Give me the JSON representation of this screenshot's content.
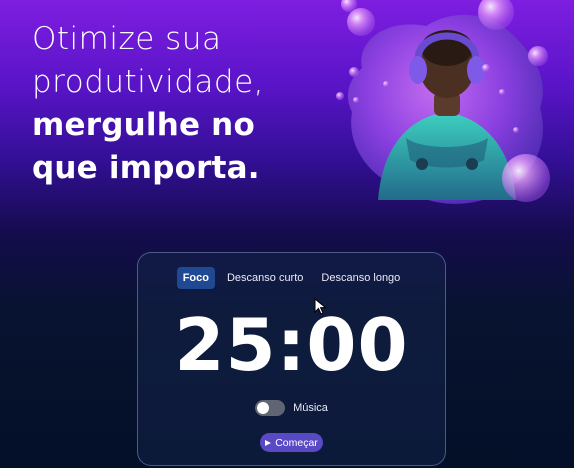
{
  "headline": {
    "line1": "Otimize sua",
    "line2": "produtividade,",
    "line3": "mergulhe no",
    "line4": "que importa."
  },
  "hero": {
    "description_icon": "headphones-character-illustration"
  },
  "timer": {
    "tabs": [
      {
        "label": "Foco",
        "active": true
      },
      {
        "label": "Descanso curto",
        "active": false
      },
      {
        "label": "Descanso longo",
        "active": false
      }
    ],
    "time": "25:00",
    "music": {
      "label": "Música",
      "enabled": false
    },
    "start_label": "Começar",
    "start_icon": "play-icon"
  },
  "colors": {
    "bg_top": "#7e1ee0",
    "bg_bottom": "#041028",
    "tab_active": "#1f4a93",
    "button": "#5a49c4",
    "toggle_off": "#5f6573"
  }
}
